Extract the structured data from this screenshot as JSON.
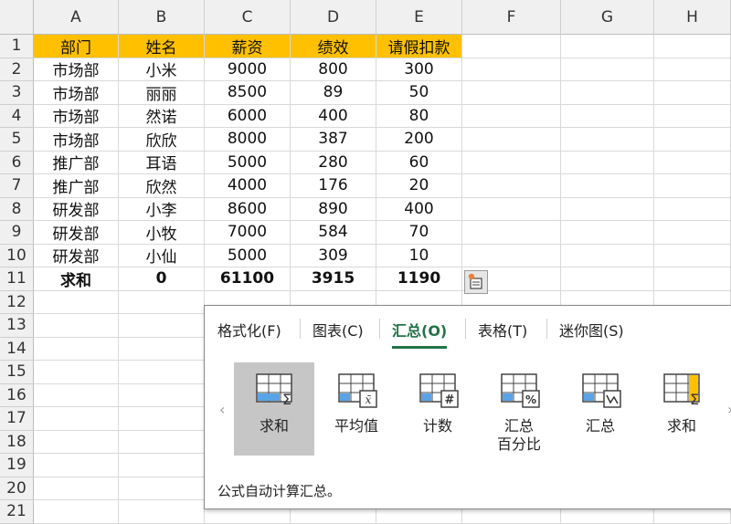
{
  "columns": [
    "A",
    "B",
    "C",
    "D",
    "E",
    "F",
    "G",
    "H"
  ],
  "rows": [
    "1",
    "2",
    "3",
    "4",
    "5",
    "6",
    "7",
    "8",
    "9",
    "10",
    "11",
    "12",
    "13",
    "14",
    "15",
    "16",
    "17",
    "18",
    "19",
    "20",
    "21"
  ],
  "table": {
    "headers": [
      "部门",
      "姓名",
      "薪资",
      "绩效",
      "请假扣款"
    ],
    "rows": [
      [
        "市场部",
        "小米",
        "9000",
        "800",
        "300"
      ],
      [
        "市场部",
        "丽丽",
        "8500",
        "89",
        "50"
      ],
      [
        "市场部",
        "然诺",
        "6000",
        "400",
        "80"
      ],
      [
        "市场部",
        "欣欣",
        "8000",
        "387",
        "200"
      ],
      [
        "推广部",
        "耳语",
        "5000",
        "280",
        "60"
      ],
      [
        "推广部",
        "欣然",
        "4000",
        "176",
        "20"
      ],
      [
        "研发部",
        "小李",
        "8600",
        "890",
        "400"
      ],
      [
        "研发部",
        "小牧",
        "7000",
        "584",
        "70"
      ],
      [
        "研发部",
        "小仙",
        "5000",
        "309",
        "10"
      ]
    ],
    "total": [
      "求和",
      "0",
      "61100",
      "3915",
      "1190"
    ]
  },
  "quick_analysis": {
    "tabs": [
      "格式化(F)",
      "图表(C)",
      "汇总(O)",
      "表格(T)",
      "迷你图(S)"
    ],
    "active_tab": 2,
    "items": [
      {
        "label": "求和",
        "icon": "sum-rows-icon"
      },
      {
        "label": "平均值",
        "icon": "average-icon"
      },
      {
        "label": "计数",
        "icon": "count-icon"
      },
      {
        "label": "汇总\n百分比",
        "icon": "percent-total-icon"
      },
      {
        "label": "汇总",
        "icon": "running-total-icon"
      },
      {
        "label": "求和",
        "icon": "sum-columns-icon"
      }
    ],
    "description": "公式自动计算汇总。"
  },
  "colors": {
    "header_fill": "#ffc000",
    "accent": "#217346",
    "selected_item": "#c6c6c6"
  }
}
